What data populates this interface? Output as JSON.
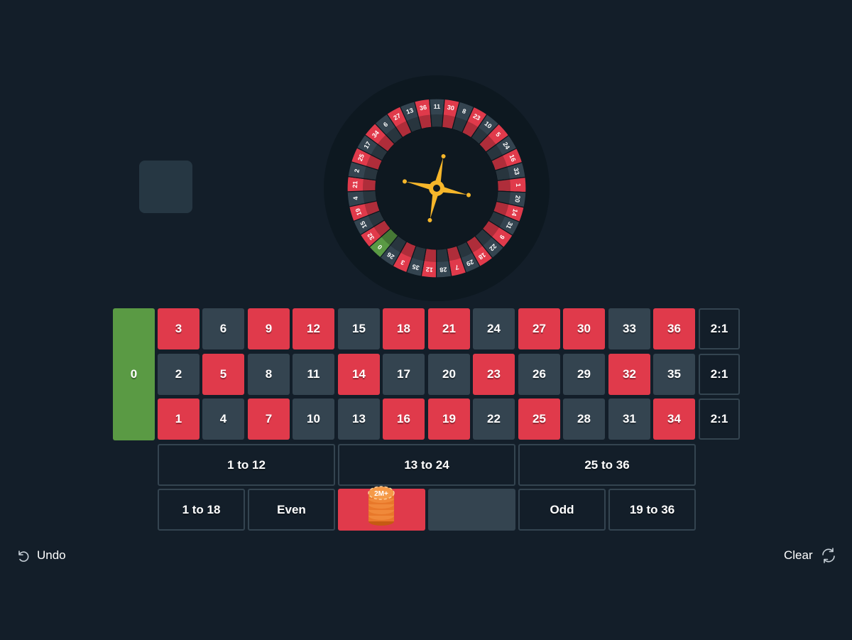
{
  "wheel": {
    "sequence": [
      "0",
      "32",
      "15",
      "19",
      "4",
      "21",
      "2",
      "25",
      "17",
      "34",
      "6",
      "27",
      "13",
      "36",
      "11",
      "30",
      "8",
      "23",
      "10",
      "5",
      "24",
      "16",
      "33",
      "1",
      "20",
      "14",
      "31",
      "9",
      "22",
      "18",
      "29",
      "7",
      "28",
      "12",
      "35",
      "3",
      "26"
    ],
    "red_numbers": [
      1,
      3,
      5,
      7,
      9,
      12,
      14,
      16,
      18,
      19,
      21,
      23,
      25,
      27,
      30,
      32,
      34,
      36
    ],
    "colors": {
      "red": "#e03a4b",
      "black": "#344450",
      "green": "#5a9a44",
      "hub": "#0e1820",
      "rim": "#0d1820",
      "pointer": "#f6b62a"
    }
  },
  "table": {
    "zero": "0",
    "rows": [
      [
        {
          "n": "3",
          "c": "red"
        },
        {
          "n": "6",
          "c": "black"
        },
        {
          "n": "9",
          "c": "red"
        },
        {
          "n": "12",
          "c": "red"
        },
        {
          "n": "15",
          "c": "black"
        },
        {
          "n": "18",
          "c": "red"
        },
        {
          "n": "21",
          "c": "red"
        },
        {
          "n": "24",
          "c": "black"
        },
        {
          "n": "27",
          "c": "red"
        },
        {
          "n": "30",
          "c": "red"
        },
        {
          "n": "33",
          "c": "black"
        },
        {
          "n": "36",
          "c": "red"
        }
      ],
      [
        {
          "n": "2",
          "c": "black"
        },
        {
          "n": "5",
          "c": "red"
        },
        {
          "n": "8",
          "c": "black"
        },
        {
          "n": "11",
          "c": "black"
        },
        {
          "n": "14",
          "c": "red"
        },
        {
          "n": "17",
          "c": "black"
        },
        {
          "n": "20",
          "c": "black"
        },
        {
          "n": "23",
          "c": "red"
        },
        {
          "n": "26",
          "c": "black"
        },
        {
          "n": "29",
          "c": "black"
        },
        {
          "n": "32",
          "c": "red"
        },
        {
          "n": "35",
          "c": "black"
        }
      ],
      [
        {
          "n": "1",
          "c": "red"
        },
        {
          "n": "4",
          "c": "black"
        },
        {
          "n": "7",
          "c": "red"
        },
        {
          "n": "10",
          "c": "black"
        },
        {
          "n": "13",
          "c": "black"
        },
        {
          "n": "16",
          "c": "red"
        },
        {
          "n": "19",
          "c": "red"
        },
        {
          "n": "22",
          "c": "black"
        },
        {
          "n": "25",
          "c": "red"
        },
        {
          "n": "28",
          "c": "black"
        },
        {
          "n": "31",
          "c": "black"
        },
        {
          "n": "34",
          "c": "red"
        }
      ]
    ],
    "columns": [
      "2:1",
      "2:1",
      "2:1"
    ],
    "dozens": [
      "1 to 12",
      "13 to 24",
      "25 to 36"
    ],
    "outside": {
      "low": "1 to 18",
      "even": "Even",
      "red": "",
      "black": "",
      "odd": "Odd",
      "high": "19 to 36"
    }
  },
  "chip": {
    "label": "2M+",
    "placed_on": "red"
  },
  "controls": {
    "undo_label": "Undo",
    "clear_label": "Clear"
  }
}
